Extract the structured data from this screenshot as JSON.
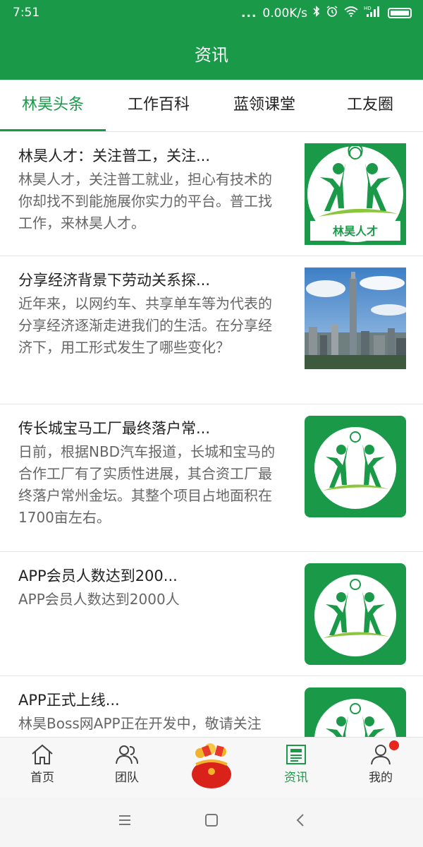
{
  "status": {
    "time": "7:51",
    "dots": "...",
    "speed": "0.00K/s",
    "signal_label": "HD"
  },
  "header": {
    "title": "资讯"
  },
  "tabs": [
    {
      "label": "林昊头条",
      "active": true
    },
    {
      "label": "工作百科",
      "active": false
    },
    {
      "label": "蓝领课堂",
      "active": false
    },
    {
      "label": "工友圈",
      "active": false
    }
  ],
  "articles": [
    {
      "title": "林昊人才：关注普工，关注...",
      "desc": "林昊人才，关注普工就业，担心有技术的你却找不到能施展你实力的平台。普工找工作，来林昊人才。",
      "thumb": "logo-with-text",
      "thumb_text": "林昊人才"
    },
    {
      "title": "分享经济背景下劳动关系探...",
      "desc": "近年来，以网约车、共享单车等为代表的分享经济逐渐走进我们的生活。在分享经济下，用工形式发生了哪些变化？",
      "thumb": "city-photo"
    },
    {
      "title": "传长城宝马工厂最终落户常...",
      "desc": "日前，根据NBD汽车报道，长城和宝马的合作工厂有了实质性进展，其合资工厂最终落户常州金坛。其整个项目占地面积在1700亩左右。",
      "thumb": "logo"
    },
    {
      "title": "APP会员人数达到200...",
      "desc": "APP会员人数达到2000人",
      "thumb": "logo"
    },
    {
      "title": "APP正式上线...",
      "desc": "林昊Boss网APP正在开发中，敬请关注",
      "thumb": "logo"
    }
  ],
  "bottom_nav": [
    {
      "label": "首页",
      "icon": "home-icon"
    },
    {
      "label": "团队",
      "icon": "team-icon"
    },
    {
      "label": "",
      "icon": "red-envelope-icon"
    },
    {
      "label": "资讯",
      "icon": "news-icon",
      "active": true
    },
    {
      "label": "我的",
      "icon": "profile-icon",
      "badge": true
    }
  ],
  "colors": {
    "brand": "#1a9a48",
    "badge": "#e8261c",
    "text": "#222222",
    "muted": "#666666"
  }
}
